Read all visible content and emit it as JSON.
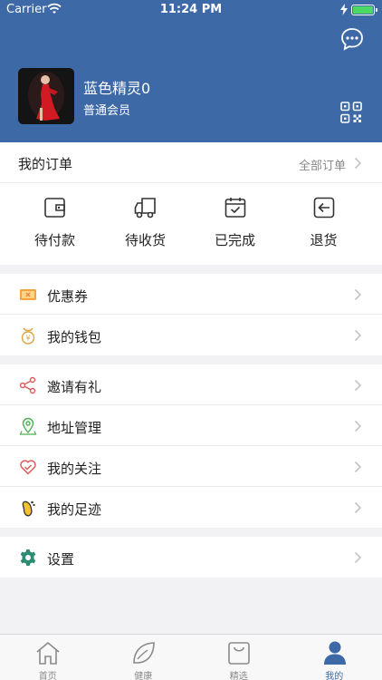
{
  "status_bar": {
    "carrier": "Carrier",
    "time": "11:24 PM"
  },
  "profile": {
    "username": "蓝色精灵0",
    "level": "普通会员"
  },
  "orders": {
    "title": "我的订单",
    "view_all": "全部订单",
    "items": [
      {
        "label": "待付款",
        "icon": "wallet-icon"
      },
      {
        "label": "待收货",
        "icon": "delivery-truck-icon"
      },
      {
        "label": "已完成",
        "icon": "calendar-check-icon"
      },
      {
        "label": "退货",
        "icon": "return-icon"
      }
    ]
  },
  "menu_group_1": [
    {
      "label": "优惠券",
      "icon": "coupon-icon"
    },
    {
      "label": "我的钱包",
      "icon": "money-bag-icon"
    }
  ],
  "menu_group_2": [
    {
      "label": "邀请有礼",
      "icon": "share-icon"
    },
    {
      "label": "地址管理",
      "icon": "location-pin-icon"
    },
    {
      "label": "我的关注",
      "icon": "heart-icon"
    },
    {
      "label": "我的足迹",
      "icon": "footprint-icon"
    }
  ],
  "menu_group_3": [
    {
      "label": "设置",
      "icon": "gear-icon"
    }
  ],
  "tabbar": [
    {
      "label": "首页",
      "icon": "home-icon",
      "active": false
    },
    {
      "label": "健康",
      "icon": "leaf-icon",
      "active": false
    },
    {
      "label": "精选",
      "icon": "shopping-bag-icon",
      "active": false
    },
    {
      "label": "我的",
      "icon": "person-icon",
      "active": true
    }
  ],
  "colors": {
    "header": "#3e69a7",
    "active_tab": "#3e69a7",
    "background": "#f2f2f4"
  }
}
